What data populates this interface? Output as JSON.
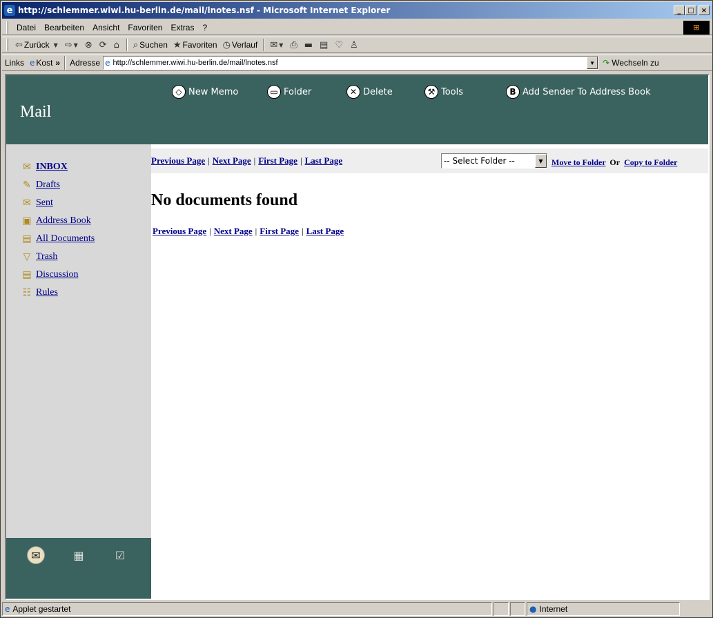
{
  "window": {
    "title": "http://schlemmer.wiwi.hu-berlin.de/mail/lnotes.nsf - Microsoft Internet Explorer",
    "controls": [
      "_",
      "□",
      "×"
    ]
  },
  "menubar": {
    "items": [
      "Datei",
      "Bearbeiten",
      "Ansicht",
      "Favoriten",
      "Extras",
      "?"
    ]
  },
  "toolbar": {
    "back_label": "Zurück",
    "search_label": "Suchen",
    "favorites_label": "Favoriten",
    "history_label": "Verlauf"
  },
  "addressbar": {
    "links_label": "Links",
    "kost_label": "Kost",
    "address_label": "Adresse",
    "url": "http://schlemmer.wiwi.hu-berlin.de/mail/lnotes.nsf",
    "go_label": "Wechseln zu"
  },
  "app": {
    "brand": "Mail",
    "actions": {
      "new_memo": "New Memo",
      "folder": "Folder",
      "delete": "Delete",
      "tools": "Tools",
      "add_sender": "Add Sender To Address Book"
    },
    "nav": [
      {
        "label": "INBOX",
        "icon": "inbox-icon"
      },
      {
        "label": "Drafts",
        "icon": "drafts-icon"
      },
      {
        "label": "Sent",
        "icon": "sent-icon"
      },
      {
        "label": "Address Book",
        "icon": "address-book-icon"
      },
      {
        "label": "All Documents",
        "icon": "all-documents-icon"
      },
      {
        "label": "Trash",
        "icon": "trash-icon"
      },
      {
        "label": "Discussion",
        "icon": "discussion-icon"
      },
      {
        "label": "Rules",
        "icon": "rules-icon"
      }
    ],
    "pager": {
      "previous": "Previous Page",
      "next": "Next Page",
      "first": "First Page",
      "last": "Last Page",
      "separator": "|"
    },
    "folder_select": {
      "selected": "-- Select Folder --"
    },
    "folder_actions": {
      "move": "Move to Folder",
      "or": "Or",
      "copy": "Copy to Folder"
    },
    "empty_message": "No documents found"
  },
  "statusbar": {
    "text": "Applet gestartet",
    "zone": "Internet"
  }
}
